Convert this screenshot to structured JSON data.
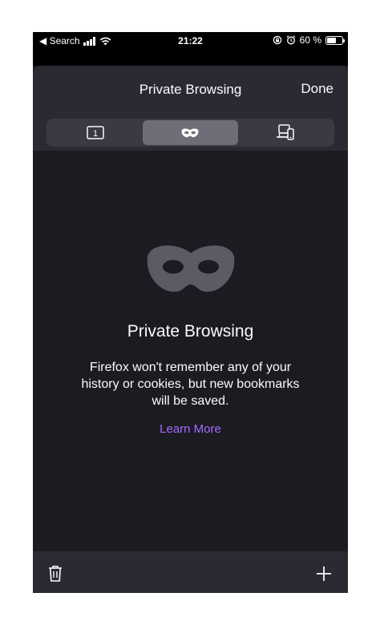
{
  "status_bar": {
    "back_label": "◀ Search",
    "time": "21:22",
    "battery_percent_label": "60 %",
    "battery_level": 0.6
  },
  "header": {
    "title": "Private Browsing",
    "done_label": "Done"
  },
  "tabs": {
    "standard_count": "1",
    "selected": "private",
    "segments": [
      "standard-tabs",
      "private-tabs",
      "synced-tabs"
    ]
  },
  "empty_state": {
    "title": "Private Browsing",
    "description": "Firefox won't remember any of your history or cookies, but new bookmarks will be saved.",
    "learn_more_label": "Learn More"
  },
  "colors": {
    "background": "#1c1b22",
    "header": "#2b2a33",
    "link": "#a66cff",
    "mask": "#5b5b66"
  },
  "icons": {
    "signal": "signal-icon",
    "wifi": "wifi-icon",
    "rotation_lock": "rotation-lock-icon",
    "alarm": "alarm-icon",
    "battery": "battery-icon",
    "mask": "private-mask-icon",
    "synced": "synced-tabs-icon",
    "trash": "trash-icon",
    "add": "plus-icon"
  }
}
